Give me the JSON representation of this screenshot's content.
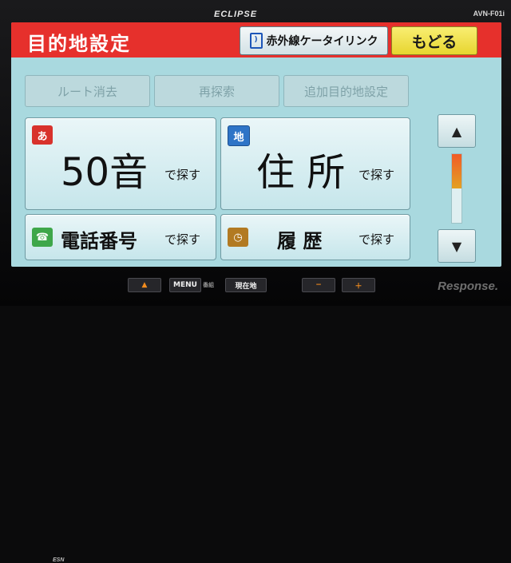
{
  "device": {
    "brand": "ECLIPSE",
    "model": "AVN-F01i"
  },
  "header": {
    "title": "目的地設定",
    "ir_button_label": "赤外線ケータイリンク",
    "back_button_label": "もどる",
    "accent_color": "#e6302c"
  },
  "sub_actions": [
    {
      "label": "ルート消去",
      "enabled": false
    },
    {
      "label": "再探索",
      "enabled": false
    },
    {
      "label": "追加目的地設定",
      "enabled": false
    }
  ],
  "search_buttons": [
    {
      "badge": "あ",
      "icon": "hiragana-icon",
      "label": "50音",
      "suffix": "で探す"
    },
    {
      "badge": "地",
      "icon": "map-address-icon",
      "label": "住 所",
      "suffix": "で探す"
    },
    {
      "badge": "☎",
      "icon": "phone-icon",
      "label": "電話番号",
      "suffix": "で探す"
    },
    {
      "badge": "◷",
      "icon": "history-icon",
      "label": "履 歴",
      "suffix": "で探す"
    }
  ],
  "scroll": {
    "up_icon": "arrow-up-icon",
    "down_icon": "arrow-down-icon",
    "position_fraction": 0.0,
    "visible_fraction": 0.5
  },
  "hardware": {
    "esn_label": "ESN",
    "menu_label": "MENU",
    "menu_sub_label": "番組",
    "genzaichi_label": "現在地",
    "minus_label": "−",
    "plus_label": "＋",
    "eject_label": "▲"
  },
  "watermark": "Response."
}
